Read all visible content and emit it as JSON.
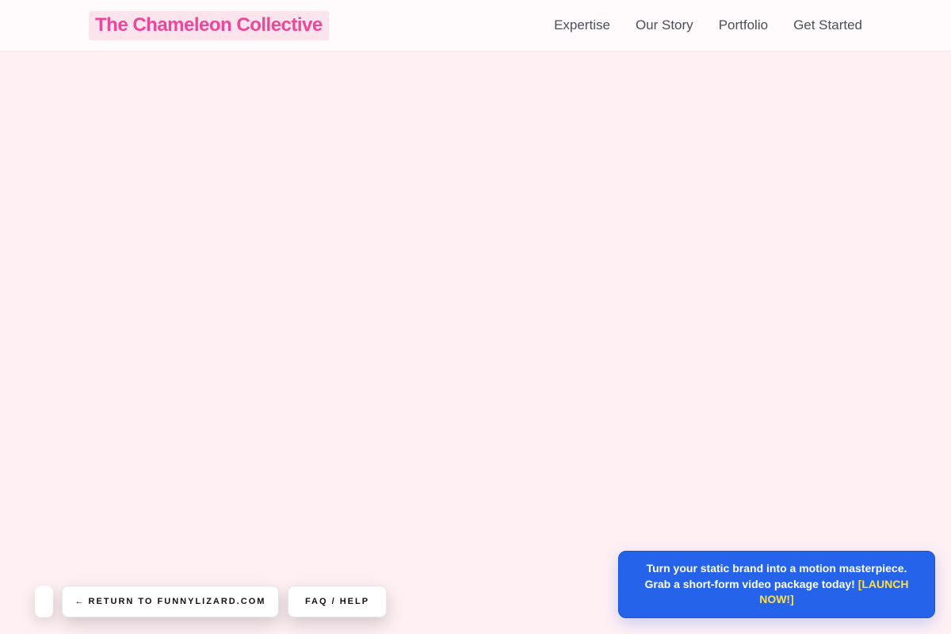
{
  "header": {
    "logo": "The Chameleon Collective",
    "nav": [
      {
        "label": "Expertise"
      },
      {
        "label": "Our Story"
      },
      {
        "label": "Portfolio"
      },
      {
        "label": "Get Started"
      }
    ]
  },
  "bottom_bar": {
    "return_arrow": "←",
    "return_label": "RETURN TO FUNNYLIZARD.COM",
    "faq_label": "FAQ / HELP"
  },
  "promo": {
    "line1": "Turn your static brand into a motion masterpiece.",
    "line2": "Grab a short-form video package today!",
    "cta": "[LAUNCH NOW!]"
  },
  "colors": {
    "page_background": "#fff0f4",
    "brand_pink": "#ec4899",
    "promo_blue": "#2563eb",
    "cta_yellow": "#fde047"
  }
}
